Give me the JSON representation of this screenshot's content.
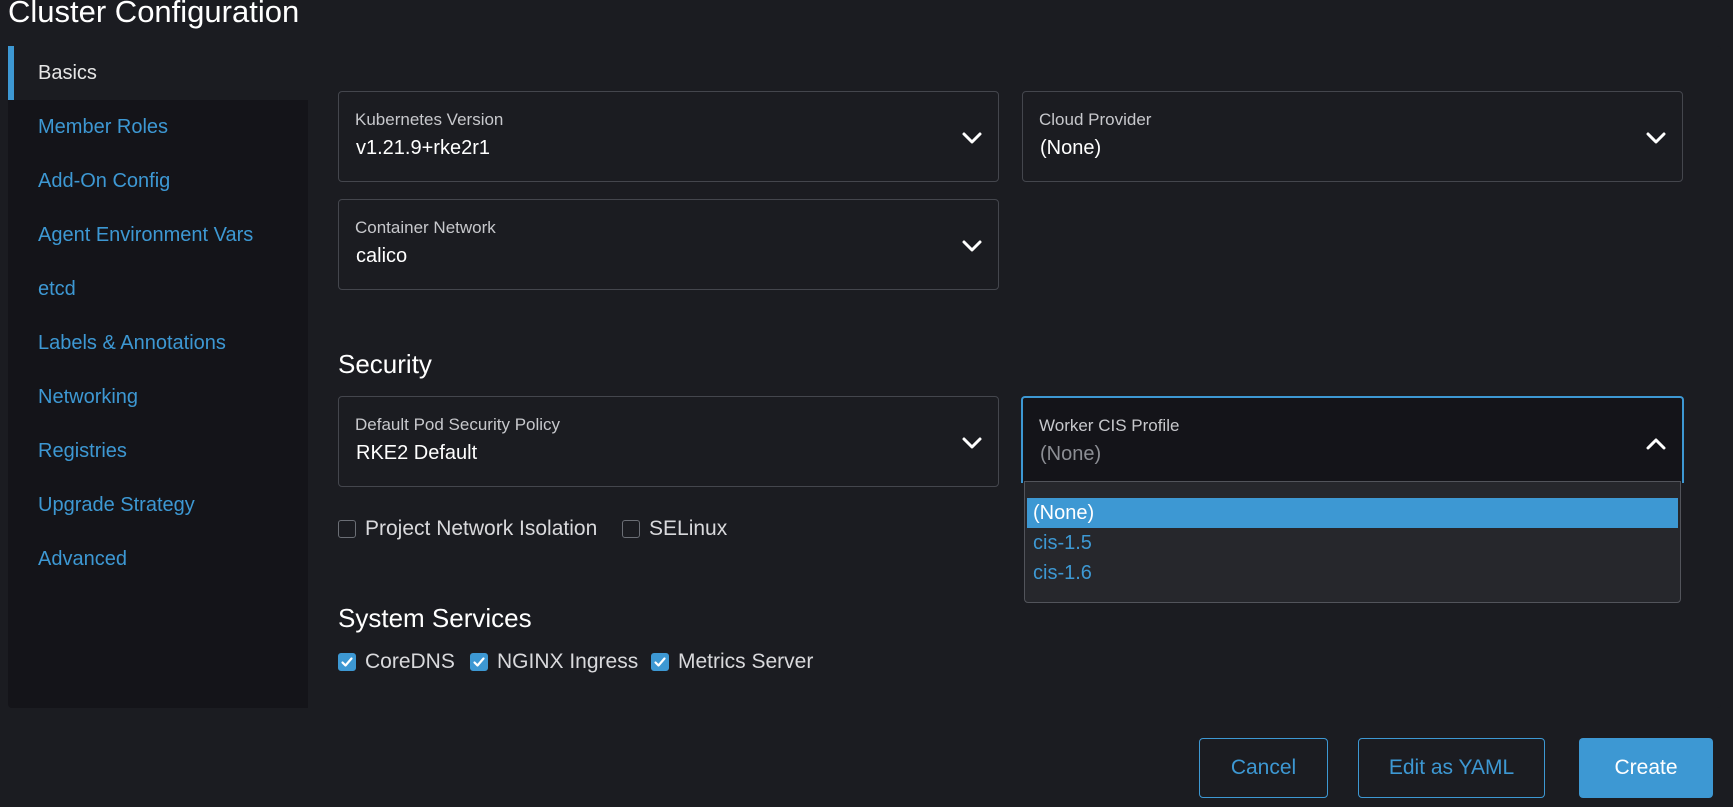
{
  "page_title": "Cluster Configuration",
  "sidebar": {
    "items": [
      {
        "label": "Basics",
        "active": true
      },
      {
        "label": "Member Roles"
      },
      {
        "label": "Add-On Config"
      },
      {
        "label": "Agent Environment Vars"
      },
      {
        "label": "etcd"
      },
      {
        "label": "Labels & Annotations"
      },
      {
        "label": "Networking"
      },
      {
        "label": "Registries"
      },
      {
        "label": "Upgrade Strategy"
      },
      {
        "label": "Advanced"
      }
    ]
  },
  "basics": {
    "kubernetes_version": {
      "label": "Kubernetes Version",
      "value": "v1.21.9+rke2r1"
    },
    "cloud_provider": {
      "label": "Cloud Provider",
      "value": "(None)"
    },
    "container_network": {
      "label": "Container Network",
      "value": "calico"
    }
  },
  "security": {
    "title": "Security",
    "pod_security_policy": {
      "label": "Default Pod Security Policy",
      "value": "RKE2 Default"
    },
    "worker_cis_profile": {
      "label": "Worker CIS Profile",
      "placeholder": "(None)",
      "options": [
        "(None)",
        "cis-1.5",
        "cis-1.6"
      ],
      "highlighted": "(None)"
    },
    "checkboxes": [
      {
        "label": "Project Network Isolation",
        "checked": false
      },
      {
        "label": "SELinux",
        "checked": false
      }
    ]
  },
  "system_services": {
    "title": "System Services",
    "checkboxes": [
      {
        "label": "CoreDNS",
        "checked": true
      },
      {
        "label": "NGINX Ingress",
        "checked": true
      },
      {
        "label": "Metrics Server",
        "checked": true
      }
    ]
  },
  "footer": {
    "cancel_label": "Cancel",
    "yaml_label": "Edit as YAML",
    "create_label": "Create"
  },
  "colors": {
    "accent": "#3d98d3",
    "background": "#1b1c21",
    "sidebar": "#141419"
  }
}
